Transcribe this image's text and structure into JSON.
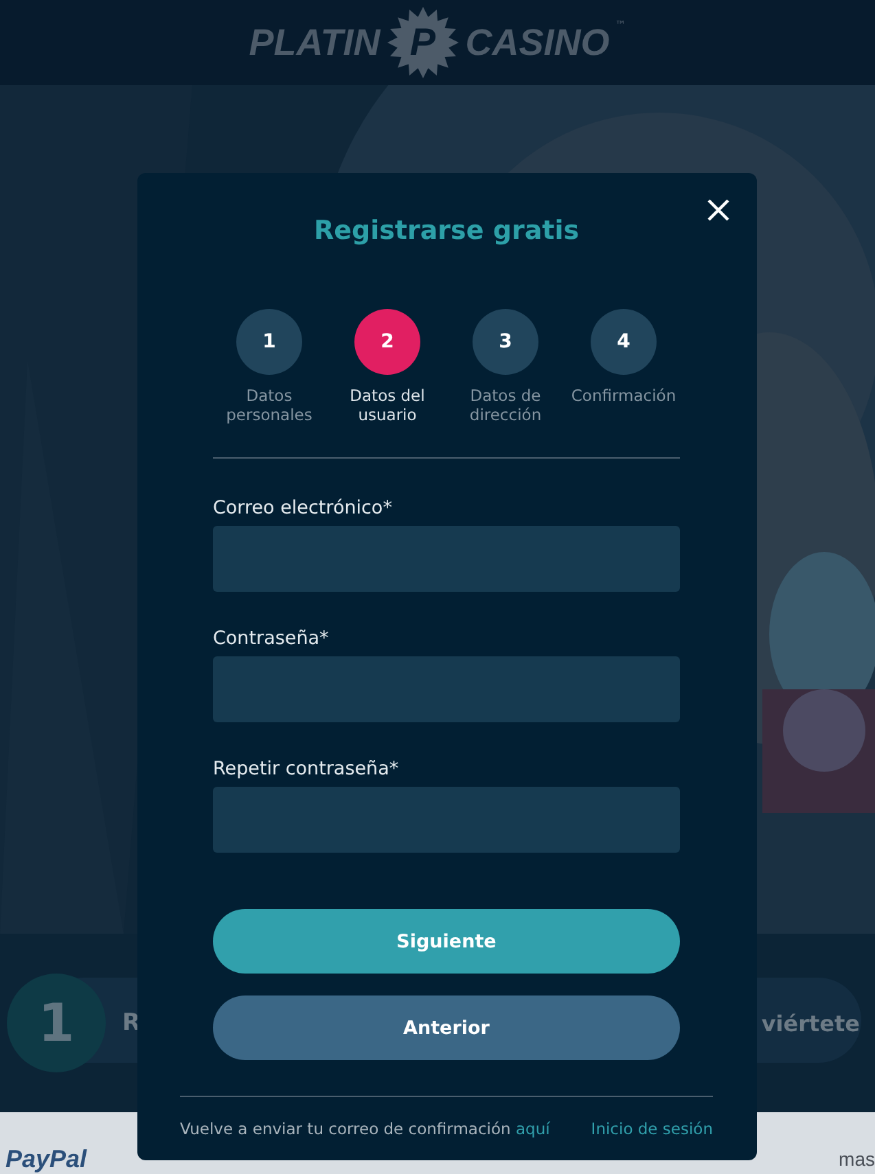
{
  "header": {
    "logo_left": "PLATIN",
    "logo_mark": "P",
    "logo_right": "CASINO",
    "trademark": "™"
  },
  "hero": {
    "kind": "picture"
  },
  "banner": {
    "step_number": "1",
    "left_text": "R",
    "right_text": "viértete"
  },
  "payments": [
    "PayPal",
    "mas"
  ],
  "modal": {
    "title": "Registrarse gratis",
    "steps": [
      {
        "number": "1",
        "label": "Datos personales",
        "selected": false
      },
      {
        "number": "2",
        "label": "Datos del usuario",
        "selected": true
      },
      {
        "number": "3",
        "label": "Datos de dirección",
        "selected": false
      },
      {
        "number": "4",
        "label": "Confirmación",
        "selected": false
      }
    ],
    "fields": [
      {
        "label": "Correo electrónico*"
      },
      {
        "label": "Contraseña*"
      },
      {
        "label": "Repetir contraseña*"
      }
    ],
    "buttons": [
      {
        "label": "Siguiente",
        "kind": "primary"
      },
      {
        "label": "Anterior",
        "kind": "secondary"
      }
    ],
    "footer": {
      "resend_text": "Vuelve a enviar tu correo de confirmación",
      "resend_link": "aquí",
      "login_link": "Inicio de sesión"
    }
  }
}
